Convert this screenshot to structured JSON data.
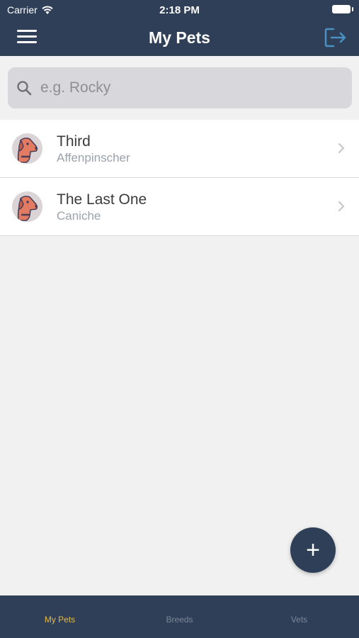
{
  "status_bar": {
    "carrier": "Carrier",
    "time": "2:18 PM"
  },
  "nav": {
    "title": "My Pets"
  },
  "search": {
    "placeholder": "e.g. Rocky",
    "value": ""
  },
  "pets": [
    {
      "name": "Third",
      "breed": "Affenpinscher"
    },
    {
      "name": "The Last One",
      "breed": "Caniche"
    }
  ],
  "fab": {
    "label": "+"
  },
  "tabs": [
    {
      "label": "My Pets",
      "active": true
    },
    {
      "label": "Breeds",
      "active": false
    },
    {
      "label": "Vets",
      "active": false
    }
  ],
  "colors": {
    "header": "#2e3f57",
    "background": "#f1f1f1",
    "active_tab": "#e7b93c",
    "inactive_tab": "#7d8798",
    "logout_icon": "#4a90c2"
  }
}
